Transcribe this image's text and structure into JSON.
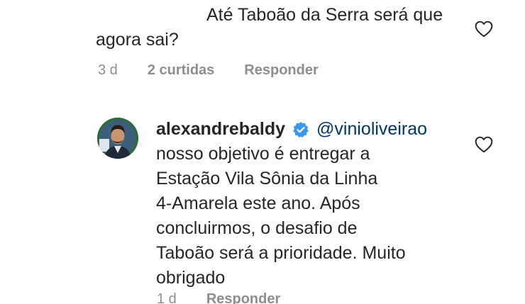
{
  "comment1": {
    "text": "Até Taboão da Serra será que agora sai?",
    "time": "3 d",
    "likes": "2 curtidas",
    "reply_label": "Responder",
    "like_icon": "heart-outline-icon"
  },
  "comment2": {
    "username": "alexandrebaldy",
    "verified_icon": "verified-badge-icon",
    "mention": "@vinioliveirao",
    "text": "nosso objetivo é entregar a\nEstação Vila Sônia da Linha\n4-Amarela este ano. Após\nconcluirmos, o desafio de\nTaboão será a prioridade. Muito\nobrigado",
    "time": "1 d",
    "reply_label": "Responder",
    "like_icon": "heart-outline-icon"
  },
  "colors": {
    "text": "#262626",
    "secondary": "#8e8e8e",
    "mention": "#00376b",
    "verified": "#3897f0",
    "avatar_ring": "#2f6d2f"
  }
}
